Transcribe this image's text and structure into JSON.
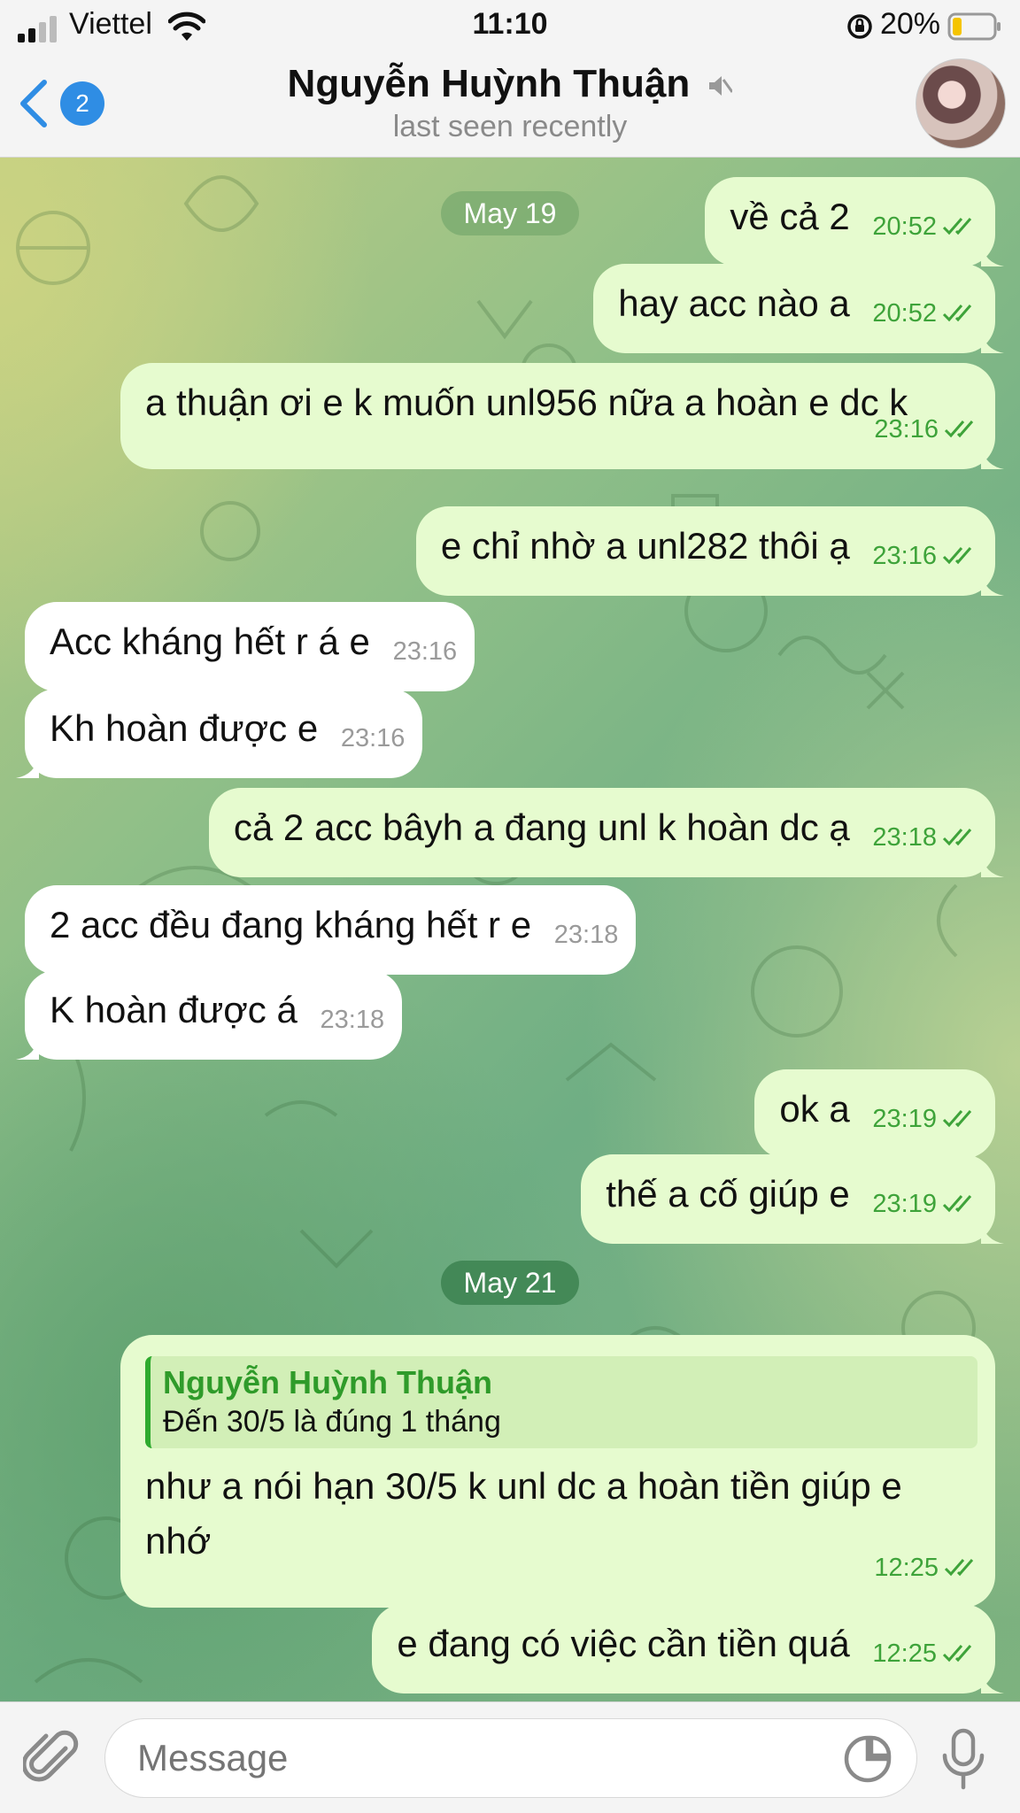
{
  "status_bar": {
    "carrier": "Viettel",
    "time": "11:10",
    "battery": "20%"
  },
  "header": {
    "back_badge": "2",
    "title": "Nguyễn Huỳnh Thuận",
    "subtitle": "last seen recently"
  },
  "dates": [
    "May 19",
    "May 21"
  ],
  "messages": [
    {
      "dir": "out",
      "text": "về cả 2",
      "time": "20:52"
    },
    {
      "dir": "out",
      "text": "hay acc nào a",
      "time": "20:52"
    },
    {
      "dir": "out",
      "text": "a thuận ơi e k muốn unl956 nữa a hoàn e dc k",
      "time": "23:16"
    },
    {
      "dir": "out",
      "text": "e chỉ nhờ a unl282 thôi ạ",
      "time": "23:16"
    },
    {
      "dir": "in",
      "text": "Acc kháng hết r á e",
      "time": "23:16"
    },
    {
      "dir": "in",
      "text": "Kh hoàn được e",
      "time": "23:16"
    },
    {
      "dir": "out",
      "text": "cả 2 acc bâyh a đang unl k hoàn dc ạ",
      "time": "23:18"
    },
    {
      "dir": "in",
      "text": "2 acc đều đang kháng hết r e",
      "time": "23:18"
    },
    {
      "dir": "in",
      "text": "K hoàn được á",
      "time": "23:18"
    },
    {
      "dir": "out",
      "text": "ok a",
      "time": "23:19"
    },
    {
      "dir": "out",
      "text": "thế a cố giúp e",
      "time": "23:19"
    },
    {
      "dir": "out",
      "text": "như a nói hạn 30/5 k unl dc a hoàn tiền giúp e nhớ",
      "time": "12:25",
      "reply": {
        "author": "Nguyễn Huỳnh Thuận",
        "text": "Đến 30/5 là đúng 1 tháng"
      }
    },
    {
      "dir": "out",
      "text": "e đang có việc cần tiền quá",
      "time": "12:25"
    }
  ],
  "input": {
    "placeholder": "Message"
  },
  "colors": {
    "outgoing_bubble": "#e6fbcf",
    "incoming_bubble": "#ffffff",
    "accent_green": "#3ea33a",
    "badge_blue": "#2f8de4"
  }
}
